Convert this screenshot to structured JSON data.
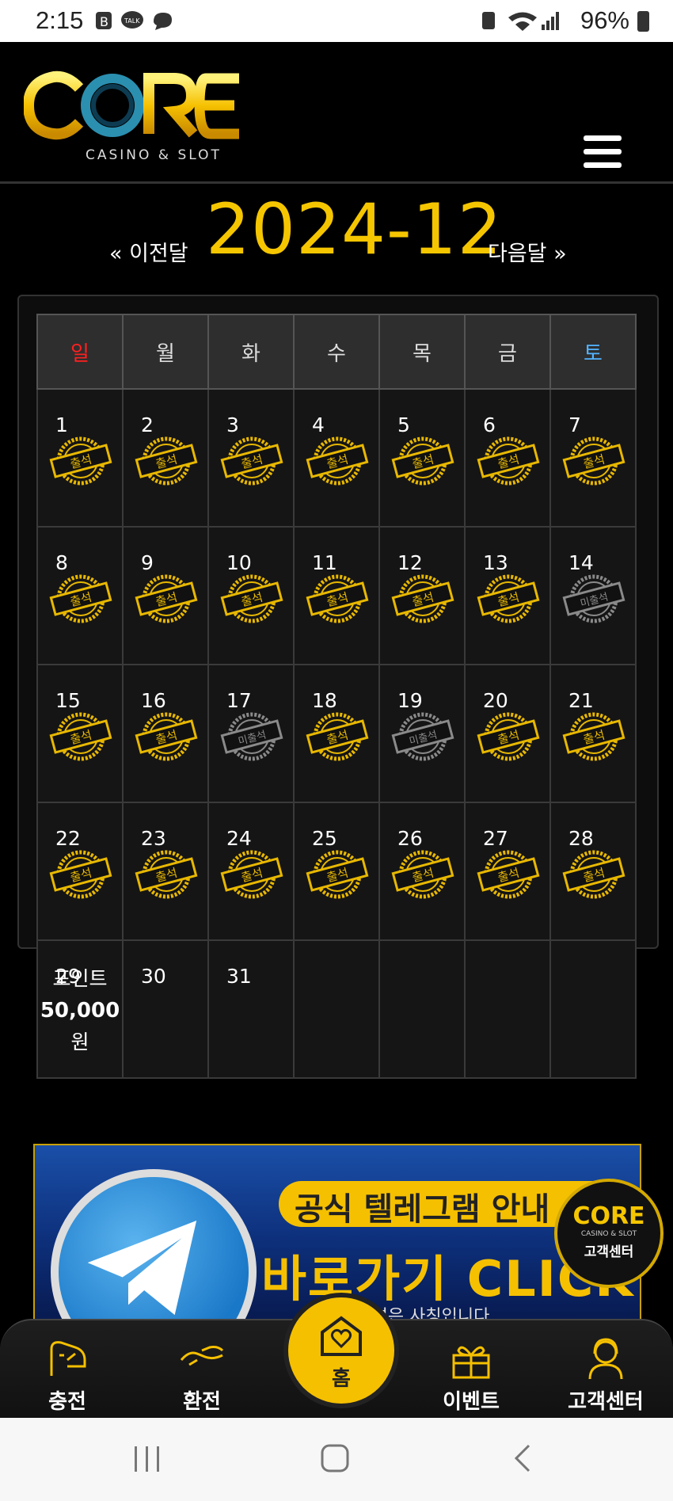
{
  "status_bar": {
    "time": "2:15",
    "battery": "96%"
  },
  "header": {
    "logo_text": "CORE",
    "logo_sub": "CASINO & SLOT"
  },
  "month_nav": {
    "prev_label": "« 이전달",
    "current": "2024-12",
    "next_label": "다음달 »"
  },
  "calendar": {
    "weekdays": [
      "일",
      "월",
      "화",
      "수",
      "목",
      "금",
      "토"
    ],
    "weekday_colors": {
      "sun": "#ff2020",
      "sat": "#52b4ff",
      "default": "#dddddd"
    },
    "stamp_attended": "출석",
    "stamp_missed": "미출석",
    "weeks": [
      [
        {
          "d": "1",
          "s": "a"
        },
        {
          "d": "2",
          "s": "a"
        },
        {
          "d": "3",
          "s": "a"
        },
        {
          "d": "4",
          "s": "a"
        },
        {
          "d": "5",
          "s": "a"
        },
        {
          "d": "6",
          "s": "a"
        },
        {
          "d": "7",
          "s": "a"
        }
      ],
      [
        {
          "d": "8",
          "s": "a"
        },
        {
          "d": "9",
          "s": "a"
        },
        {
          "d": "10",
          "s": "a"
        },
        {
          "d": "11",
          "s": "a"
        },
        {
          "d": "12",
          "s": "a"
        },
        {
          "d": "13",
          "s": "a"
        },
        {
          "d": "14",
          "s": "m"
        }
      ],
      [
        {
          "d": "15",
          "s": "a"
        },
        {
          "d": "16",
          "s": "a"
        },
        {
          "d": "17",
          "s": "m"
        },
        {
          "d": "18",
          "s": "a"
        },
        {
          "d": "19",
          "s": "m"
        },
        {
          "d": "20",
          "s": "a"
        },
        {
          "d": "21",
          "s": "a"
        }
      ],
      [
        {
          "d": "22",
          "s": "a"
        },
        {
          "d": "23",
          "s": "a"
        },
        {
          "d": "24",
          "s": "a"
        },
        {
          "d": "25",
          "s": "a"
        },
        {
          "d": "26",
          "s": "a"
        },
        {
          "d": "27",
          "s": "a"
        },
        {
          "d": "28",
          "s": "a"
        }
      ],
      [
        {
          "d": "29",
          "s": ""
        },
        {
          "d": "30",
          "s": ""
        },
        {
          "d": "31",
          "s": ""
        },
        {
          "d": "",
          "s": ""
        },
        {
          "d": "",
          "s": ""
        },
        {
          "d": "",
          "s": ""
        },
        {
          "d": "",
          "s": ""
        }
      ]
    ],
    "reward": {
      "line1": "포인트",
      "amount": "50,000",
      "unit": "원"
    }
  },
  "banner": {
    "title": "공식 텔레그램 안내",
    "cta": "바로가기 CLICK",
    "sub": "...외 본 채널은 사칭입니다"
  },
  "cs_badge": {
    "logo": "CORE",
    "sub": "CASINO & SLOT",
    "label": "고객센터"
  },
  "bottom_nav": {
    "deposit": "충전",
    "withdraw": "환전",
    "home": "홈",
    "event": "이벤트",
    "support": "고객센터"
  },
  "colors": {
    "accent": "#f5c000",
    "background": "#000000"
  }
}
